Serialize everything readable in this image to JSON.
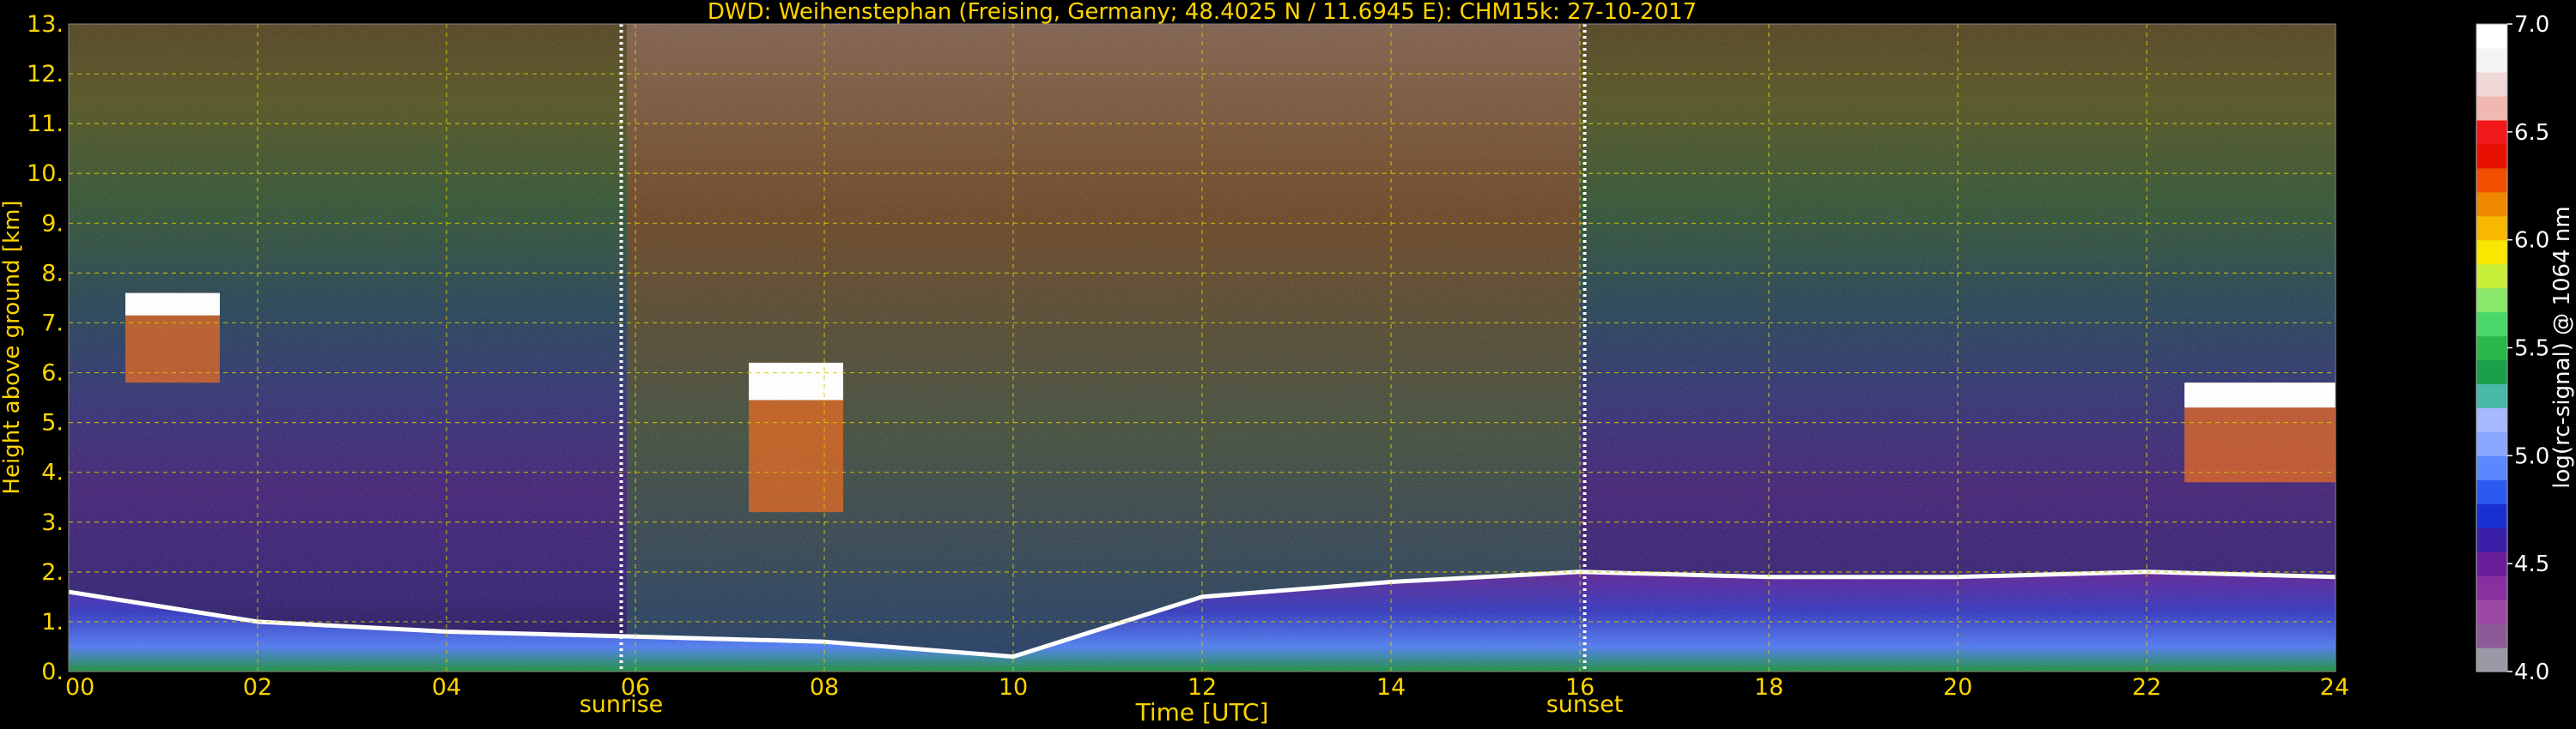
{
  "chart_data": {
    "type": "heatmap",
    "title": "DWD: Weihenstephan (Freising, Germany; 48.4025 N / 11.6945 E):    CHM15k: 27-10-2017",
    "xlabel": "Time [UTC]",
    "ylabel": "Height above ground [km]",
    "xlim": [
      0,
      24
    ],
    "ylim": [
      0,
      13
    ],
    "x_ticks": [
      "00",
      "02",
      "04",
      "06",
      "08",
      "10",
      "12",
      "14",
      "16",
      "18",
      "20",
      "22",
      "24"
    ],
    "y_ticks": [
      "0.",
      "1.",
      "2.",
      "3.",
      "4.",
      "5.",
      "6.",
      "7.",
      "8.",
      "9.",
      "10.",
      "11.",
      "12.",
      "13."
    ],
    "grid": true,
    "markers": [
      {
        "label": "sunrise",
        "x": 5.85
      },
      {
        "label": "sunset",
        "x": 16.05
      }
    ],
    "colorbar": {
      "label": "log(rc-signal) @ 1064 nm",
      "range": [
        4.0,
        7.0
      ],
      "ticks": [
        "4.0",
        "4.5",
        "5.0",
        "5.5",
        "6.0",
        "6.5",
        "7.0"
      ],
      "colors": [
        "#9a9aa6",
        "#8d5a98",
        "#9a48a4",
        "#8a2fa0",
        "#6a1f9a",
        "#3a1fa8",
        "#1a2fd0",
        "#2a5aee",
        "#5a88ff",
        "#8aa8ff",
        "#a8b8ff",
        "#4ab8a8",
        "#1aa04a",
        "#2ab84a",
        "#4ad86a",
        "#8ae86a",
        "#c8f03a",
        "#f8e800",
        "#f8b800",
        "#f08800",
        "#f05000",
        "#e81000",
        "#f01818",
        "#f0b8b0",
        "#f0d8d8",
        "#f4f4f4",
        "#ffffff"
      ]
    },
    "layers": [
      {
        "name": "boundary_layer_top",
        "x": [
          0,
          2,
          4,
          6,
          8,
          10,
          12,
          14,
          16,
          18,
          20,
          22,
          24
        ],
        "y": [
          1.6,
          1.0,
          0.8,
          0.7,
          0.6,
          0.3,
          1.5,
          1.8,
          2.0,
          1.9,
          1.9,
          2.0,
          1.9
        ]
      }
    ],
    "clouds": [
      {
        "x": [
          0.6,
          1.6
        ],
        "y": [
          5.8,
          7.6
        ]
      },
      {
        "x": [
          7.2,
          8.2
        ],
        "y": [
          3.2,
          6.2
        ]
      },
      {
        "x": [
          22.4,
          24
        ],
        "y": [
          3.8,
          5.8
        ]
      }
    ]
  }
}
